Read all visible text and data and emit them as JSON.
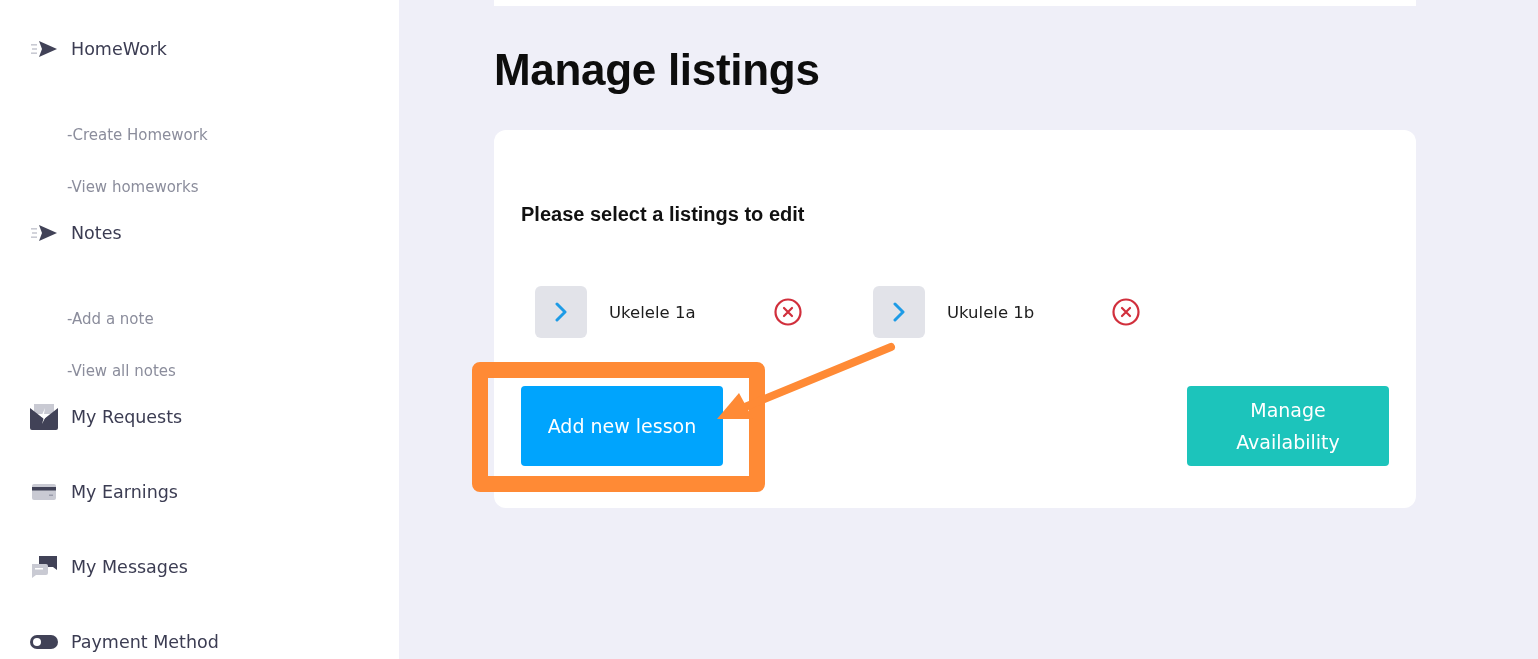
{
  "sidebar": {
    "items": [
      {
        "label": "HomeWork",
        "kind": "send",
        "children": [
          {
            "label": "-Create Homework"
          },
          {
            "label": "-View homeworks"
          }
        ]
      },
      {
        "label": "Notes",
        "kind": "send",
        "children": [
          {
            "label": "-Add a note"
          },
          {
            "label": "-View all notes"
          }
        ]
      },
      {
        "label": "My Requests",
        "kind": "requests"
      },
      {
        "label": "My Earnings",
        "kind": "earnings"
      },
      {
        "label": "My Messages",
        "kind": "messages"
      },
      {
        "label": "Payment Method",
        "kind": "payment"
      }
    ]
  },
  "page": {
    "title": "Manage listings"
  },
  "listings_card": {
    "prompt": "Please select a listings to edit",
    "listings": [
      {
        "name": "Ukelele 1a"
      },
      {
        "name": "Ukulele 1b"
      }
    ],
    "buttons": [
      {
        "label": "Add new lesson",
        "kind": "primary",
        "highlighted": true
      },
      {
        "label": "Manage Availability",
        "kind": "secondary",
        "highlighted": false
      }
    ]
  }
}
